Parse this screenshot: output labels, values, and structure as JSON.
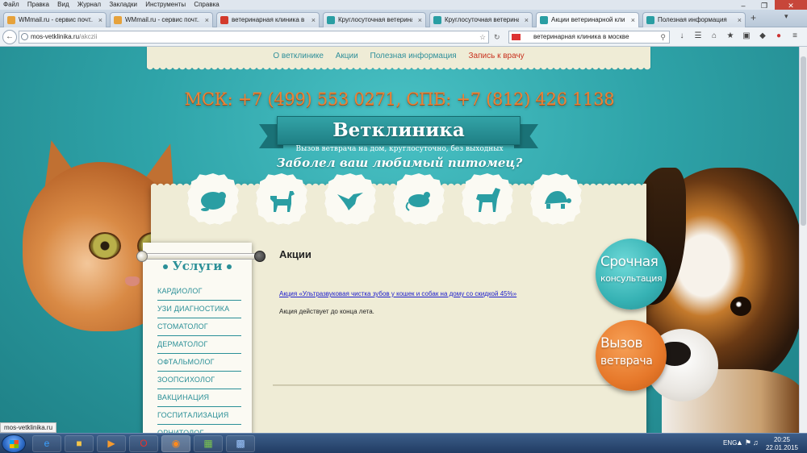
{
  "browser": {
    "menu": [
      "Файл",
      "Правка",
      "Вид",
      "Журнал",
      "Закладки",
      "Инструменты",
      "Справка"
    ],
    "tabs": [
      {
        "title": "WMmail.ru - сервис почт...",
        "color": "#e6a23c"
      },
      {
        "title": "WMmail.ru - сервис почт...",
        "color": "#e6a23c"
      },
      {
        "title": "ветеринарная клиника в ...",
        "color": "#d33a2c"
      },
      {
        "title": "Круглосуточная ветерина...",
        "color": "#2a9ea3"
      },
      {
        "title": "Круглосуточная ветерина...",
        "color": "#2a9ea3"
      },
      {
        "title": "Акции ветеринарной кли...",
        "color": "#2a9ea3"
      },
      {
        "title": "Полезная информация",
        "color": "#2a9ea3"
      }
    ],
    "url_host": "mos-vetklinika.ru",
    "url_path": "/akczii",
    "search_value": "ветеринарная клиника в москве",
    "status_text": "mos-vetklinika.ru"
  },
  "site": {
    "nav": [
      "О ветклинике",
      "Акции",
      "Полезная информация"
    ],
    "nav_signup": "Запись к врачу",
    "phones": "МСК: +7 (499) 553 0271, СПБ: +7 (812) 426 1138",
    "brand": "Ветклиника",
    "tagline": "Вызов ветврача на дом, круглосуточно, без выходных",
    "slogan": "Заболел ваш любимый питомец?",
    "sidebar_title": "Услуги",
    "services": [
      "КАРДИОЛОГ",
      "УЗИ ДИАГНОСТИКА",
      "СТОМАТОЛОГ",
      "ДЕРМАТОЛОГ",
      "ОФТАЛЬМОЛОГ",
      "ЗООПСИХОЛОГ",
      "ВАКЦИНАЦИЯ",
      "ГОСПИТАЛИЗАЦИЯ",
      "ОРНИТОЛОГ"
    ],
    "content_title": "Акции",
    "promo_link": "Акция «Ультразвуковая чистка зубов у кошек и собак на дому со скидкой 45%»",
    "promo_note": "Акция действует до конца лета.",
    "cta_urgent": {
      "line1": "Срочная",
      "line2": "консультация"
    },
    "cta_vet": {
      "line1": "Вызов",
      "line2": "ветврача"
    }
  },
  "taskbar": {
    "lang": "ENG",
    "time": "20:25",
    "date": "22.01.2015"
  },
  "colors": {
    "accent_teal": "#2a9ea3",
    "accent_orange": "#e6782a",
    "panel_cream": "#efecd6"
  }
}
